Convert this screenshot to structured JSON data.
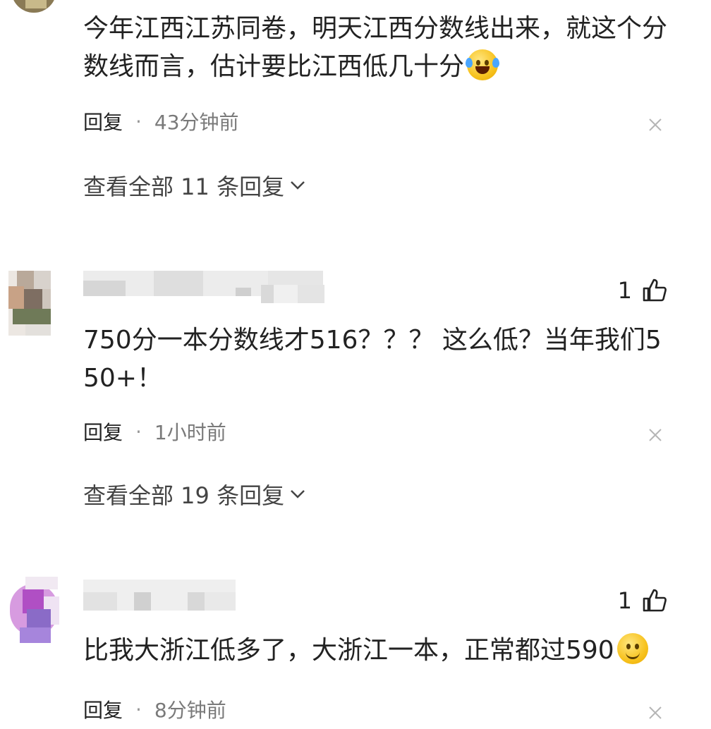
{
  "comments": [
    {
      "text": "今年江西江苏同卷，明天江西分数线出来，就这个分数线而言，估计要比江西低几十分",
      "emoji": "laughing-tears-emoji",
      "reply_label": "回复",
      "separator": "·",
      "time": "43分钟前",
      "view_all": "查看全部 11 条回复"
    },
    {
      "likes": "1",
      "text": "750分一本分数线才516？？？ 这么低？当年我们550+！",
      "reply_label": "回复",
      "separator": "·",
      "time": "1小时前",
      "view_all": "查看全部 19 条回复"
    },
    {
      "likes": "1",
      "text": "比我大浙江低多了，大浙江一本，正常都过590",
      "emoji": "smile-emoji",
      "reply_label": "回复",
      "separator": "·",
      "time": "8分钟前"
    }
  ],
  "colors": {
    "text": "#222222",
    "meta": "#777777",
    "background": "#ffffff"
  }
}
